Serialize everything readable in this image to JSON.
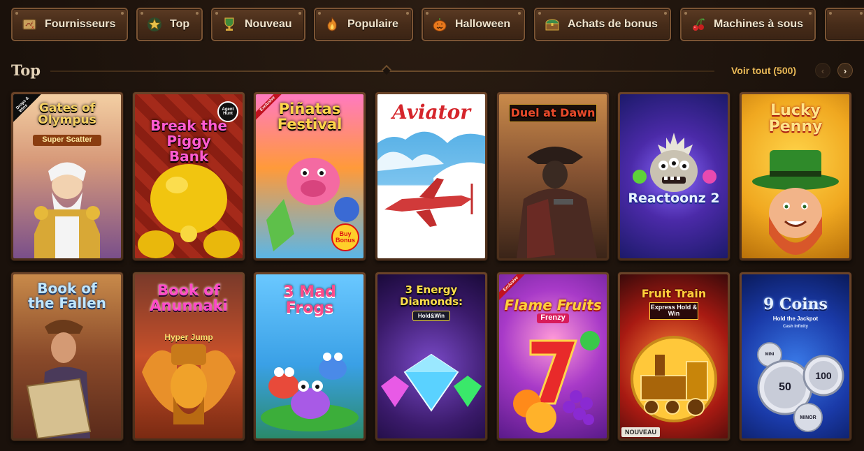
{
  "categories": [
    {
      "label": "Fournisseurs",
      "icon": "treasure-map-icon"
    },
    {
      "label": "Top",
      "icon": "star-icon"
    },
    {
      "label": "Nouveau",
      "icon": "trophy-icon"
    },
    {
      "label": "Populaire",
      "icon": "flame-icon"
    },
    {
      "label": "Halloween",
      "icon": "pumpkin-icon"
    },
    {
      "label": "Achats de bonus",
      "icon": "treasure-chest-icon"
    },
    {
      "label": "Machines à sous",
      "icon": "cherries-icon"
    }
  ],
  "section": {
    "title": "Top",
    "see_all": "Voir tout (500)"
  },
  "games": [
    {
      "title": "Gates of Olympus",
      "subtitle": "Super Scatter",
      "badge": "Drops & Wins",
      "theme": "olympus"
    },
    {
      "title": "Break the Piggy Bank",
      "badge": "Agent Hunt",
      "theme": "piggy"
    },
    {
      "title": "Piñatas Festival",
      "badge": "Exclusive",
      "extra": "Buy Bonus",
      "theme": "pinatas"
    },
    {
      "title": "Aviator",
      "theme": "aviator"
    },
    {
      "title": "Duel at Dawn",
      "theme": "duel"
    },
    {
      "title": "Reactoonz 2",
      "theme": "reactoonz"
    },
    {
      "title": "Lucky Penny",
      "theme": "penny"
    },
    {
      "title": "Book of the Fallen",
      "theme": "fallen"
    },
    {
      "title": "Book of Anunnaki",
      "subtitle": "Hyper Jump",
      "theme": "anunnaki"
    },
    {
      "title": "3 Mad Frogs",
      "theme": "frogs"
    },
    {
      "title": "3 Energy Diamonds:",
      "subtitle": "Hold&Win",
      "theme": "diamonds"
    },
    {
      "title": "Flame Fruits",
      "subtitle": "Frenzy",
      "badge": "Exclusive",
      "theme": "flame"
    },
    {
      "title": "Fruit Train",
      "subtitle": "Express Hold & Win",
      "badge": "NOUVEAU",
      "theme": "train"
    },
    {
      "title": "9 Coins",
      "subtitle": "Hold the Jackpot",
      "extra": "Cash Infinity",
      "coin_values": [
        "50",
        "100",
        "MINI",
        "MINOR"
      ],
      "theme": "coins"
    }
  ],
  "colors": {
    "accent_gold": "#e9b957",
    "background": "#1c130d",
    "tab_wood": "#4a2e1a"
  }
}
